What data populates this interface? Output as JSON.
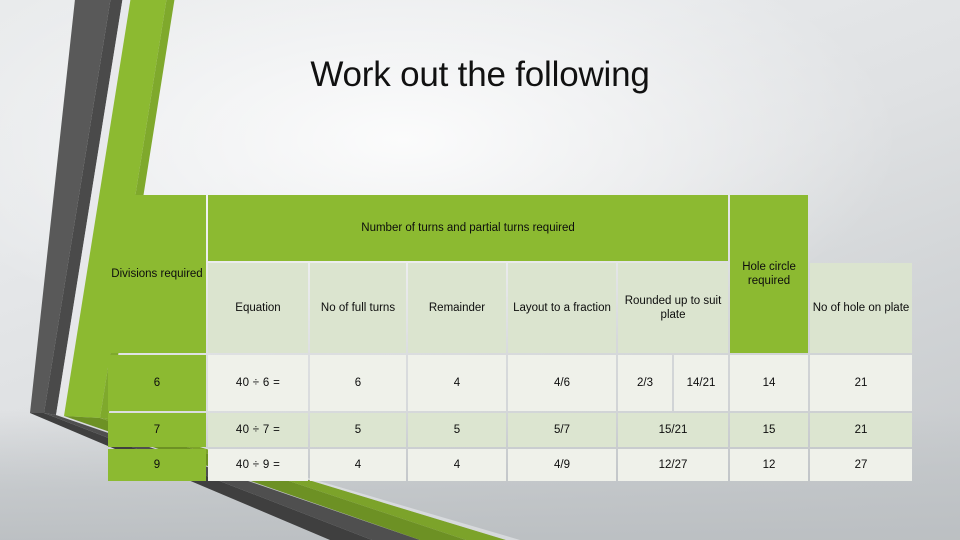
{
  "slide": {
    "title": "Work out the following",
    "background_color": "#d4d7d9",
    "accent_green": "#8cba31",
    "accent_dark": "#595959"
  },
  "decoration": {
    "name": "chevron-accent-shape",
    "green_color": "#8cba31",
    "green_shadow_color": "#6d9124",
    "gray_color": "#595959",
    "gray_shadow_color": "#404040"
  },
  "table": {
    "group_headers": {
      "divisions_required": "Divisions required",
      "number_of_turns": "Number of turns and partial turns required",
      "hole_circle": "Hole circle required"
    },
    "column_headers": {
      "blank": "",
      "equation": "Equation",
      "full_turns": "No of full turns",
      "remainder": "Remainder",
      "layout_fraction": "Layout to a fraction",
      "rounded_up": "Rounded up to suit plate",
      "holes_on_plate": "No of hole on plate",
      "hole_circle_blank": ""
    },
    "rows": [
      {
        "divisions": "6",
        "equation": "40 ÷ 6 =",
        "full_turns": "6",
        "remainder": "4",
        "layout_fraction": "4/6",
        "rounded_up_a": "2/3",
        "rounded_up_b": "14/21",
        "holes_on_plate": "14",
        "hole_circle": "21"
      },
      {
        "divisions": "7",
        "equation": "40 ÷ 7 =",
        "full_turns": "5",
        "remainder": "5",
        "layout_fraction": "5/7",
        "rounded_up": "15/21",
        "holes_on_plate": "15",
        "hole_circle": "21"
      },
      {
        "divisions": "9",
        "equation": "40 ÷ 9 =",
        "full_turns": "4",
        "remainder": "4",
        "layout_fraction": "4/9",
        "rounded_up": "12/27",
        "holes_on_plate": "12",
        "hole_circle": "27"
      }
    ]
  }
}
